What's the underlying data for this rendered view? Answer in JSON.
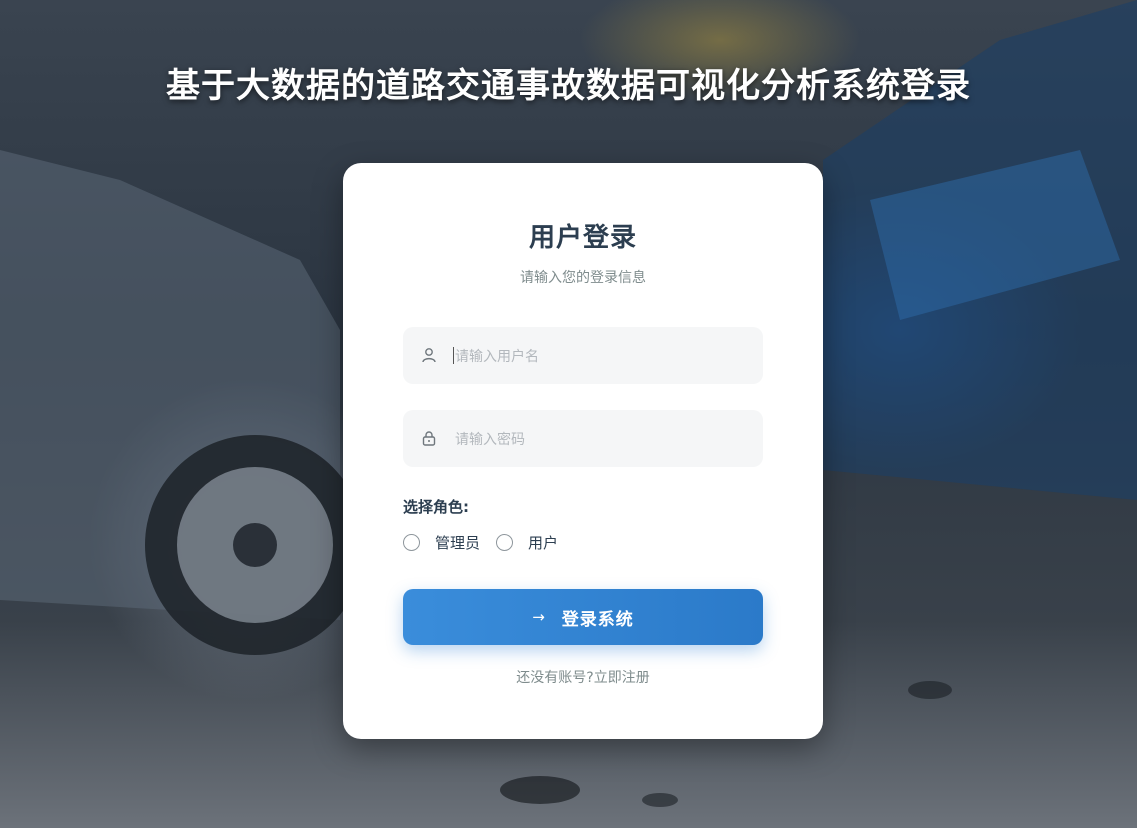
{
  "page": {
    "title": "基于大数据的道路交通事故数据可视化分析系统登录"
  },
  "login_card": {
    "title": "用户登录",
    "subtitle": "请输入您的登录信息",
    "username": {
      "value": "",
      "placeholder": "请输入用户名",
      "icon": "user-icon"
    },
    "password": {
      "value": "",
      "placeholder": "请输入密码",
      "icon": "lock-icon"
    },
    "role_label": "选择角色:",
    "roles": [
      {
        "label": "管理员",
        "selected": false
      },
      {
        "label": "用户",
        "selected": false
      }
    ],
    "submit_label": "登录系统",
    "submit_icon": "arrow-right-icon",
    "register_text": "还没有账号?立即注册"
  },
  "colors": {
    "accent": "#3484d4",
    "title_text": "#2c3e50",
    "muted_text": "#7f8c8d",
    "field_bg": "#f5f6f7"
  }
}
